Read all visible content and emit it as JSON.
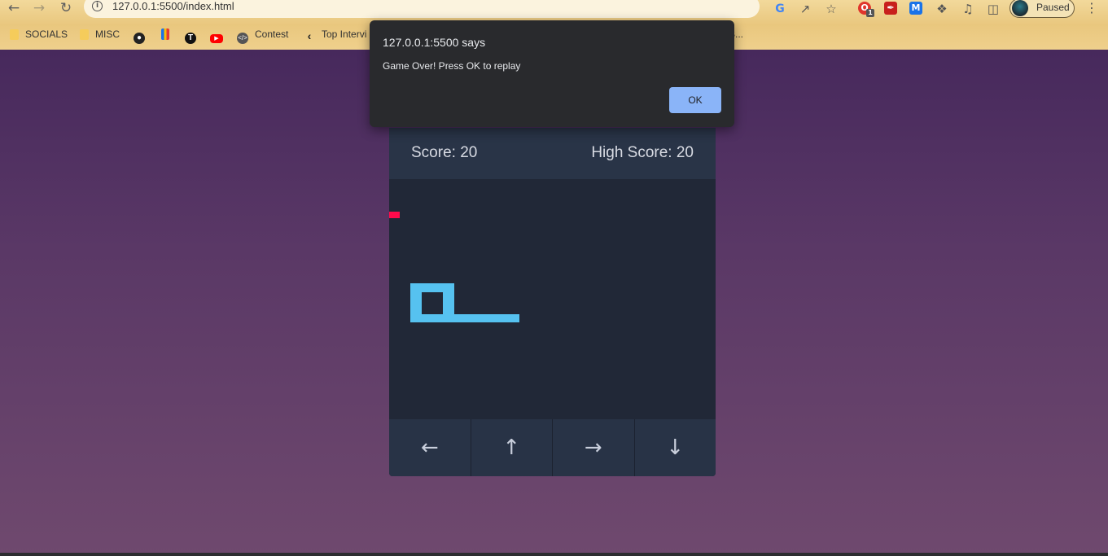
{
  "browser": {
    "url": "127.0.0.1:5500/index.html",
    "profile_status": "Paused",
    "extension_badge": "1",
    "bookmarks": [
      {
        "label": "SOCIALS",
        "icon": "folder-icon"
      },
      {
        "label": "MISC",
        "icon": "folder-icon"
      },
      {
        "label": "",
        "icon": "github-icon"
      },
      {
        "label": "",
        "icon": "bar-chart-icon"
      },
      {
        "label": "",
        "icon": "t-logo-icon"
      },
      {
        "label": "",
        "icon": "youtube-icon"
      },
      {
        "label": "Contest",
        "icon": "code-icon"
      },
      {
        "label": "Top Intervi",
        "icon": "chevron-logo-icon"
      }
    ],
    "bookmark_trailing": "S..."
  },
  "dialog": {
    "title": "127.0.0.1:5500 says",
    "message": "Game Over! Press OK to replay",
    "ok_label": "OK"
  },
  "game": {
    "score_text": "Score: 20",
    "high_score_text": "High Score: 20",
    "controls": [
      {
        "label": "←",
        "icon": "arrow-left-icon"
      },
      {
        "label": "↑",
        "icon": "arrow-up-icon"
      },
      {
        "label": "→",
        "icon": "arrow-right-icon"
      },
      {
        "label": "↓",
        "icon": "arrow-down-icon"
      }
    ]
  },
  "colors": {
    "snake": "#56c2f0",
    "food": "#ff0a4b",
    "board": "#212837",
    "header": "#293447",
    "ok_button": "#8ab4f8",
    "dialog_bg": "#292a2d"
  }
}
